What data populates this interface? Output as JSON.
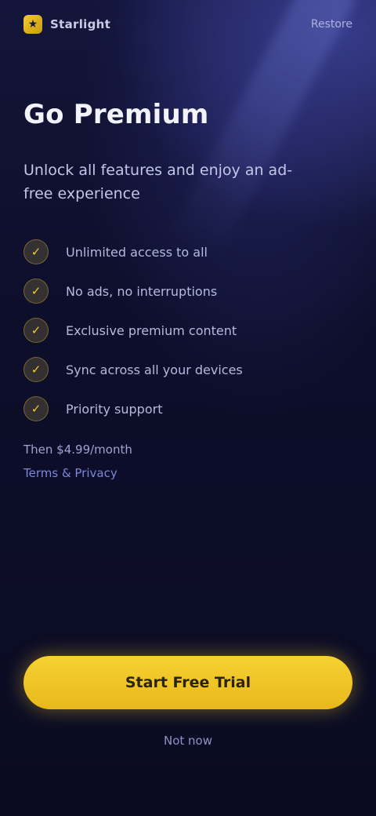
{
  "header": {
    "brand_icon": "★",
    "brand_name": "Starlight",
    "restore_label": "Restore"
  },
  "main": {
    "title": "Go Premium",
    "subtitle": "Unlock all features and enjoy an ad-free experience",
    "features": [
      {
        "icon": "check-icon",
        "label": "Unlimited access to all"
      },
      {
        "icon": "check-icon",
        "label": "No ads, no interruptions"
      },
      {
        "icon": "check-icon",
        "label": "Exclusive premium content"
      },
      {
        "icon": "check-icon",
        "label": "Sync across all your devices"
      },
      {
        "icon": "check-icon",
        "label": "Priority support"
      }
    ],
    "price_line": "Then $4.99/month",
    "terms_label": "Terms & Privacy"
  },
  "footer": {
    "cta_label": "Start Free Trial",
    "skip_label": "Not now"
  },
  "colors": {
    "accent": "#f4cc2c",
    "background": "#0b0c24"
  }
}
